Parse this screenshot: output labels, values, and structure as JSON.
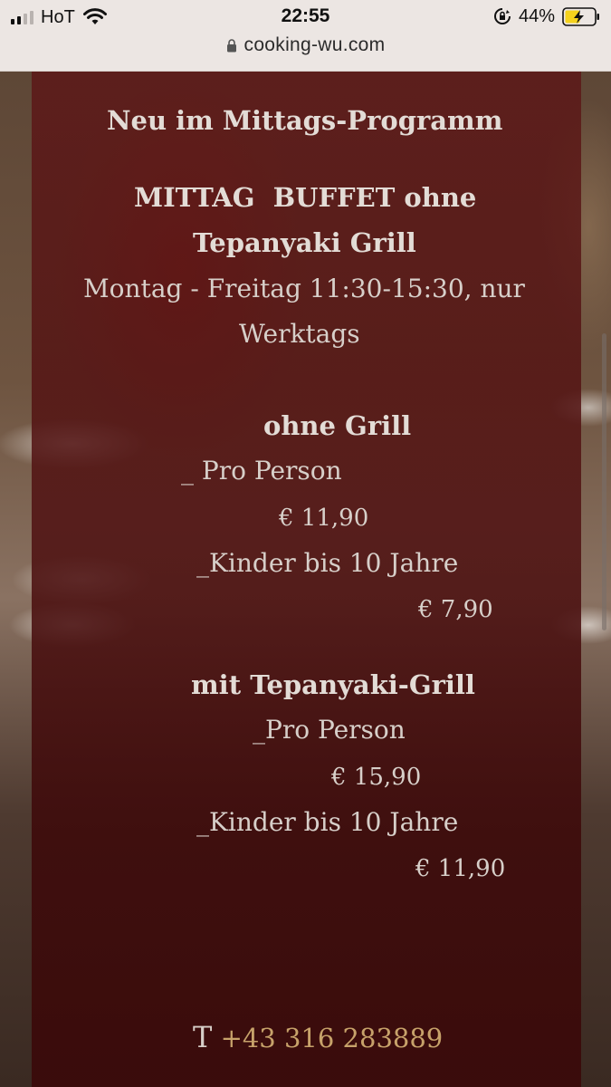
{
  "status_bar": {
    "carrier": "HoT",
    "time": "22:55",
    "battery": "44%",
    "url": "cooking-wu.com"
  },
  "menu": {
    "heading": "Neu im Mittags-Programm",
    "title_line1": "MITTAG  BUFFET ohne",
    "title_line2": "Tepanyaki Grill",
    "hours_line1": "Montag - Freitag 11:30-15:30, nur",
    "hours_line2": "Werktags",
    "section1": {
      "title": "ohne Grill",
      "adult_label": "_ Pro Person",
      "adult_price": "€ 11,90",
      "child_label": "_Kinder bis 10 Jahre",
      "child_price": "€ 7,90"
    },
    "section2": {
      "title": "mit Tepanyaki-Grill",
      "adult_label": "_Pro Person",
      "adult_price": "€ 15,90",
      "child_label": "_Kinder bis 10 Jahre",
      "child_price": "€ 11,90"
    }
  },
  "contact": {
    "phone_prefix": "T",
    "phone": "+43 316 283889"
  },
  "colors": {
    "panel": "#5c1616",
    "text": "#ddd6d0",
    "link": "#c7a26a"
  }
}
